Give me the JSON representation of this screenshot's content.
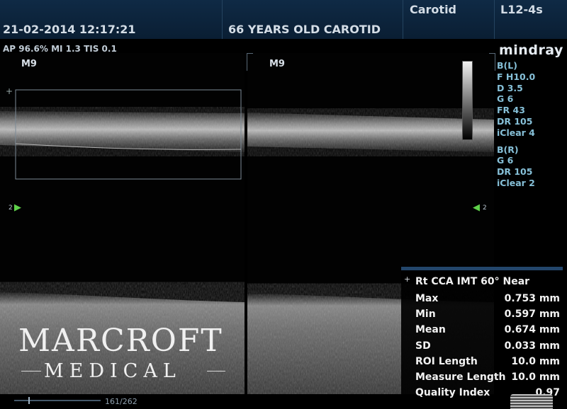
{
  "header": {
    "datetime": "21-02-2014 12:17:21",
    "patient_info": "66 YEARS  OLD CAROTID",
    "exam": "Carotid",
    "probe": "L12-4s",
    "acoustic": "AP 96.6%  MI 1.3 TIS 0.1",
    "brand": "mindray"
  },
  "left_panel": {
    "mode": "M9",
    "marker": "2"
  },
  "right_panel": {
    "mode": "M9",
    "marker": "2"
  },
  "params": {
    "b_left": [
      "B(L)",
      "F H10.0",
      "D 3.5",
      "G 6",
      "FR 43",
      "DR 105",
      "iClear 4"
    ],
    "b_right": [
      "B(R)",
      "G 6",
      "DR 105",
      "iClear 2"
    ]
  },
  "measurement": {
    "title": "Rt CCA IMT 60° Near",
    "rows": [
      {
        "label": "Max",
        "value": "0.753 mm"
      },
      {
        "label": "Min",
        "value": "0.597 mm"
      },
      {
        "label": "Mean",
        "value": "0.674 mm"
      },
      {
        "label": "SD",
        "value": "0.033 mm"
      },
      {
        "label": "ROI Length",
        "value": "10.0 mm"
      },
      {
        "label": "Measure Length",
        "value": "10.0 mm"
      },
      {
        "label": "Quality Index",
        "value": "0.97"
      }
    ]
  },
  "cine": {
    "frame": "161/262"
  },
  "watermark": {
    "line1": "MARCROFT",
    "line2": "MEDICAL"
  }
}
